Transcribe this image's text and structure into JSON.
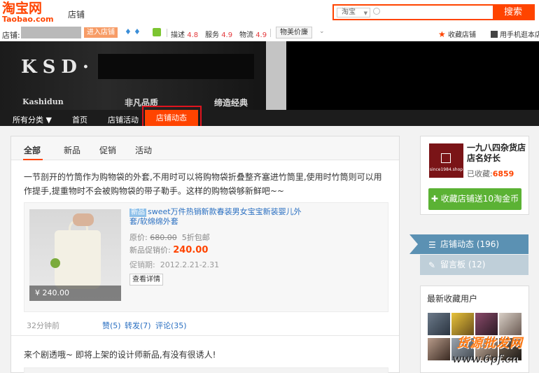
{
  "header": {
    "logo_main": "淘宝网",
    "logo_sub": "Taobao.com",
    "section": "店铺",
    "search_scope": "淘宝",
    "search_button": "搜索"
  },
  "shop_bar": {
    "shop_label": "店铺:",
    "enter_button": "进入店铺",
    "ratings": [
      {
        "label": "描述",
        "value": "4.8"
      },
      {
        "label": "服务",
        "value": "4.9"
      },
      {
        "label": "物流",
        "value": "4.9"
      }
    ],
    "value_button": "物美价廉",
    "favorite_shop": "收藏店铺",
    "phone_shop": "用手机逛本店"
  },
  "banner": {
    "brand": "KSD·",
    "brand_en": "Kashidun",
    "slogan1": "非凡品质",
    "slogan2": "缔造经典"
  },
  "nav": {
    "items": [
      "所有分类 ▼",
      "首页",
      "店铺活动",
      "店铺动态"
    ],
    "active": "店铺动态"
  },
  "feed": {
    "tabs": [
      "全部",
      "新品",
      "促销",
      "活动"
    ],
    "post1": {
      "text": "一节剖开的竹筒作为购物袋的外套,不用时可以将购物袋折叠整齐塞进竹筒里,使用时竹筒则可以用作提手,提重物时不会被购物袋的带子勒手。这样的购物袋够新鲜吧~~",
      "product": {
        "price_tag": "¥ 240.00",
        "tag": "新品",
        "title": "sweet万件热销新款春装男女宝宝新装婴儿外套/软绵绵外套",
        "orig_label": "原价:",
        "orig_price": "680.00",
        "discount": "5折包邮",
        "promo_label": "新品促销价:",
        "promo_price": "240.00",
        "period_label": "促销期:",
        "period": "2012.2.21-2.31",
        "detail_button": "查看详情"
      },
      "time": "32分钟前",
      "like": "赞(5)",
      "forward": "转发(7)",
      "comment": "评论(35)"
    },
    "post2": {
      "text": "来个剧透哦~ 即将上架的设计师新品,有没有很诱人!"
    }
  },
  "shop_card": {
    "logo_text": "since1984.shop",
    "name": "一九八四杂货店店名好长",
    "fav_label": "已收藏:",
    "fav_count": "6859",
    "fav_button": "收藏店铺送10淘金币"
  },
  "side_tabs": {
    "dynamics": "店铺动态 (196)",
    "message": "留言板 (12)"
  },
  "users": {
    "title": "最新收藏用户"
  },
  "watermark": {
    "line1": "货源批发网",
    "line2": "www.6pf.cn"
  },
  "colors": {
    "accent": "#ff4400",
    "link": "#2a6fc1",
    "green": "#5bb234"
  }
}
